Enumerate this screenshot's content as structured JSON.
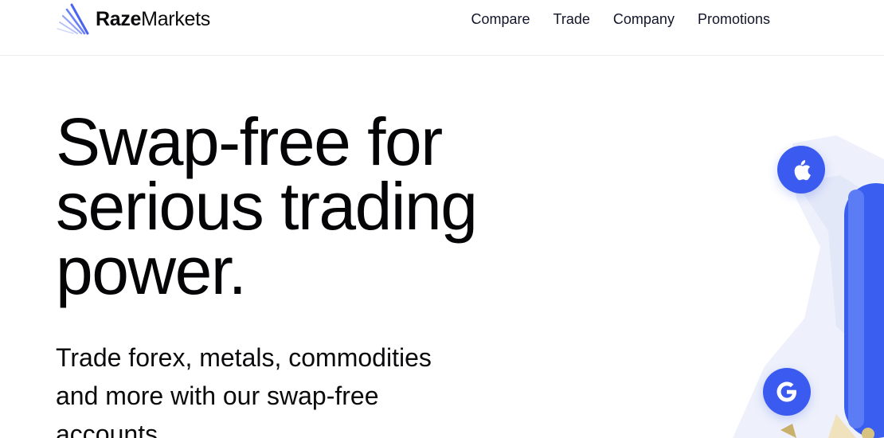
{
  "brand": {
    "name_bold": "Raze",
    "name_thin": "Markets",
    "accent": "#3b5bf0"
  },
  "nav": {
    "items": [
      {
        "label": "Compare"
      },
      {
        "label": "Trade"
      },
      {
        "label": "Company"
      },
      {
        "label": "Promotions"
      }
    ]
  },
  "hero": {
    "title_lines": [
      "Swap-free for",
      "serious trading",
      "power."
    ],
    "subtitle_lines": [
      "Trade forex, metals, commodities",
      "and more with our swap-free",
      "accounts."
    ]
  },
  "illustration": {
    "icons": [
      "apple-icon",
      "google-icon"
    ]
  }
}
